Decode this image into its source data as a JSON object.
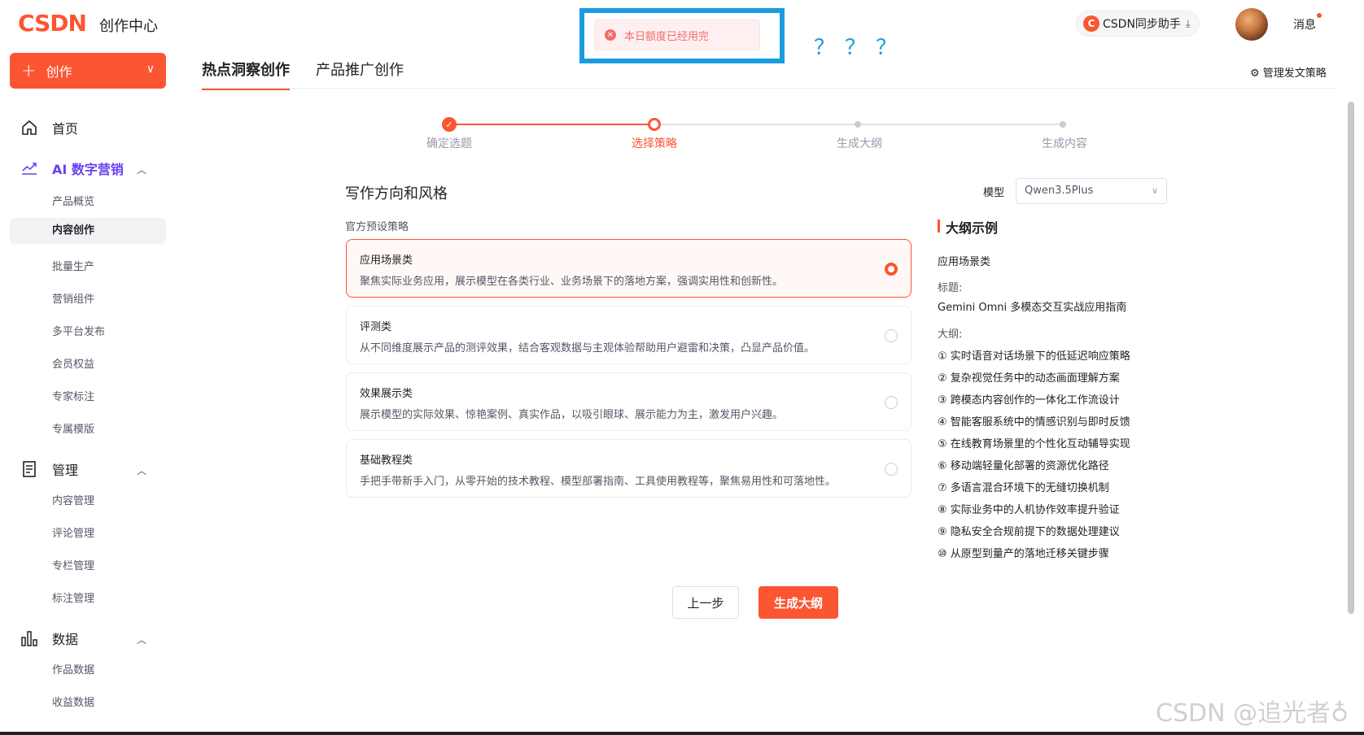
{
  "header": {
    "logo": "CSDN",
    "logo_sub": "创作中心",
    "toast": "本日额度已经用完",
    "annotation": "？？？",
    "sync_label": "CSDN同步助手",
    "messages": "消息"
  },
  "sidebar": {
    "create": "创作",
    "home": "首页",
    "ai_group": "AI 数字营销",
    "ai_items": [
      "产品概览",
      "内容创作",
      "批量生产",
      "营销组件",
      "多平台发布",
      "会员权益",
      "专家标注",
      "专属模版"
    ],
    "manage_group": "管理",
    "manage_items": [
      "内容管理",
      "评论管理",
      "专栏管理",
      "标注管理"
    ],
    "data_group": "数据",
    "data_items": [
      "作品数据",
      "收益数据"
    ]
  },
  "main": {
    "tabs": [
      "热点洞察创作",
      "产品推广创作"
    ],
    "manage_link": "管理发文策略",
    "steps": [
      "确定选题",
      "选择策略",
      "生成大纲",
      "生成内容"
    ],
    "section_title": "写作方向和风格",
    "model_label": "模型",
    "model_value": "Qwen3.5Plus",
    "preset_label": "官方预设策略",
    "cards": [
      {
        "title": "应用场景类",
        "desc": "聚焦实际业务应用，展示模型在各类行业、业务场景下的落地方案，强调实用性和创新性。"
      },
      {
        "title": "评测类",
        "desc": "从不同维度展示产品的测评效果，结合客观数据与主观体验帮助用户避雷和决策，凸显产品价值。"
      },
      {
        "title": "效果展示类",
        "desc": "展示模型的实际效果、惊艳案例、真实作品，以吸引眼球、展示能力为主，激发用户兴趣。"
      },
      {
        "title": "基础教程类",
        "desc": "手把手带新手入门，从零开始的技术教程、模型部署指南、工具使用教程等，聚焦易用性和可落地性。"
      }
    ],
    "outline": {
      "title": "大纲示例",
      "category": "应用场景类",
      "title_label": "标题:",
      "example_title": "Gemini Omni 多模态交互实战应用指南",
      "outline_label": "大纲:",
      "items": [
        "① 实时语音对话场景下的低延迟响应策略",
        "② 复杂视觉任务中的动态画面理解方案",
        "③ 跨模态内容创作的一体化工作流设计",
        "④ 智能客服系统中的情感识别与即时反馈",
        "⑤ 在线教育场景里的个性化互动辅导实现",
        "⑥ 移动端轻量化部署的资源优化路径",
        "⑦ 多语言混合环境下的无缝切换机制",
        "⑧ 实际业务中的人机协作效率提升验证",
        "⑨ 隐私安全合规前提下的数据处理建议",
        "⑩ 从原型到量产的落地迁移关键步骤"
      ]
    },
    "prev_btn": "上一步",
    "next_btn": "生成大纲"
  },
  "watermark": "CSDN @追光者♁",
  "colors": {
    "brand": "#fc5531",
    "accent_purple": "#6a3ff2",
    "annotation_blue": "#1a9ce0"
  }
}
